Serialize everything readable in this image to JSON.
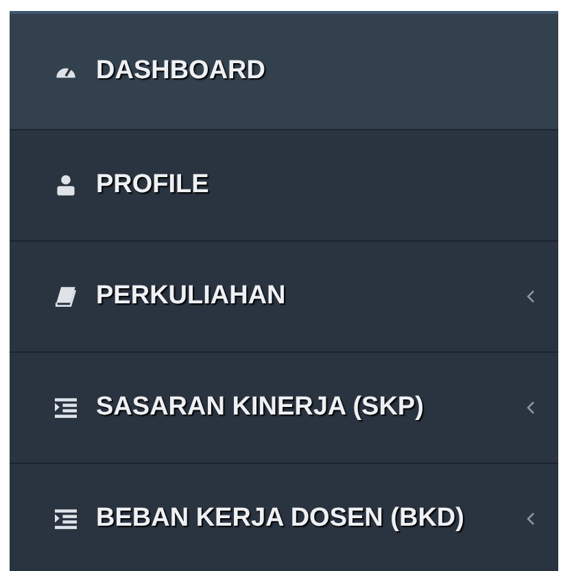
{
  "sidebar": {
    "items": [
      {
        "label": "DASHBOARD",
        "kind": "dashboard",
        "selected": true,
        "has_submenu": false
      },
      {
        "label": "PROFILE",
        "kind": "user",
        "selected": false,
        "has_submenu": false
      },
      {
        "label": "PERKULIAHAN",
        "kind": "book",
        "selected": false,
        "has_submenu": true
      },
      {
        "label": "SASARAN KINERJA (SKP)",
        "kind": "indent",
        "selected": false,
        "has_submenu": true
      },
      {
        "label": "BEBAN KERJA DOSEN (BKD)",
        "kind": "indent",
        "selected": false,
        "has_submenu": true
      }
    ]
  }
}
